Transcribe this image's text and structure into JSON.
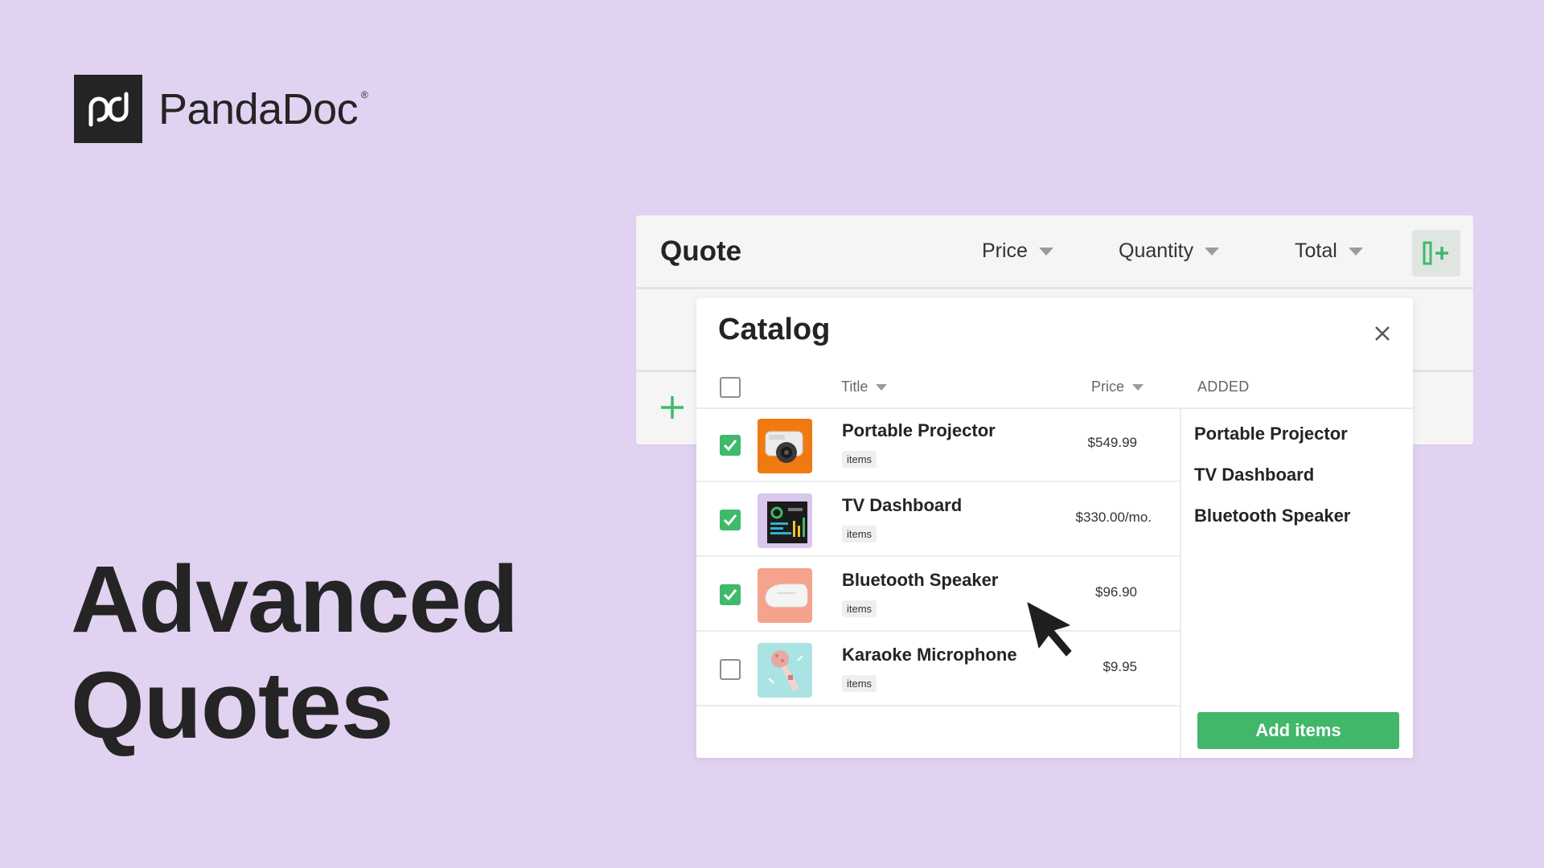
{
  "brand": {
    "name": "PandaDoc",
    "registered_mark": "®"
  },
  "headline": {
    "line1": "Advanced",
    "line2": "Quotes"
  },
  "quote": {
    "title": "Quote",
    "columns": [
      "Price",
      "Quantity",
      "Total"
    ],
    "add_column_icon": "add-column-icon",
    "add_row_icon": "plus-icon"
  },
  "catalog": {
    "title": "Catalog",
    "headers": {
      "title": "Title",
      "price": "Price",
      "added": "ADDED"
    },
    "items": [
      {
        "title": "Portable Projector",
        "tag": "items",
        "price": "$549.99",
        "checked": true,
        "thumb_color": "#f07a12"
      },
      {
        "title": "TV Dashboard",
        "tag": "items",
        "price": "$330.00/mo.",
        "checked": true,
        "thumb_color": "#d9c7ee"
      },
      {
        "title": "Bluetooth Speaker",
        "tag": "items",
        "price": "$96.90",
        "checked": true,
        "thumb_color": "#f6a38e"
      },
      {
        "title": "Karaoke Microphone",
        "tag": "items",
        "price": "$9.95",
        "checked": false,
        "thumb_color": "#a9e3e3"
      }
    ],
    "added": [
      "Portable Projector",
      "TV Dashboard",
      "Bluetooth Speaker"
    ],
    "add_button_label": "Add items"
  },
  "colors": {
    "background": "#e1d2f1",
    "accent_green": "#41b76a",
    "dark": "#242424"
  }
}
